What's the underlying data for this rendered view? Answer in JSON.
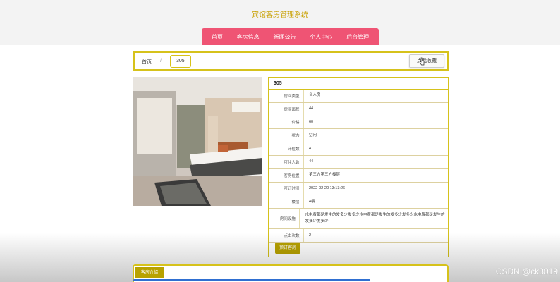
{
  "header": {
    "site_title": "宾馆客房管理系统",
    "nav": [
      "首页",
      "客房信息",
      "新闻公告",
      "个人中心",
      "后台管理"
    ]
  },
  "breadcrumb": {
    "home": "首页",
    "separator": "/",
    "current": "305"
  },
  "actions": {
    "favorite_label": "点我收藏"
  },
  "room": {
    "title": "305",
    "fields": [
      {
        "label": "房间类型:",
        "value": "台人房"
      },
      {
        "label": "房间面积:",
        "value": "44"
      },
      {
        "label": "价格:",
        "value": "60"
      },
      {
        "label": "状态:",
        "value": "空闲"
      },
      {
        "label": "床位数:",
        "value": "4"
      },
      {
        "label": "可住人数:",
        "value": "44"
      },
      {
        "label": "客房位置:",
        "value": "第三方第三方楼层"
      },
      {
        "label": "可订时间:",
        "value": "2022-02-20 13:13:26"
      },
      {
        "label": "楼层:",
        "value": "4楼"
      },
      {
        "label": "房间设施:",
        "value": "水电费都是发生的发多少发多少水电费都是发生的发多少发多少水电费都是发生的发多少发多少"
      },
      {
        "label": "点击次数:",
        "value": "2"
      }
    ],
    "book_label": "预订客房"
  },
  "intro": {
    "tab_label": "客房介绍"
  },
  "watermark": "CSDN @ck3019",
  "colors": {
    "accent": "#d6c21b",
    "nav_bg": "#ef5474",
    "button": "#b8a200"
  }
}
